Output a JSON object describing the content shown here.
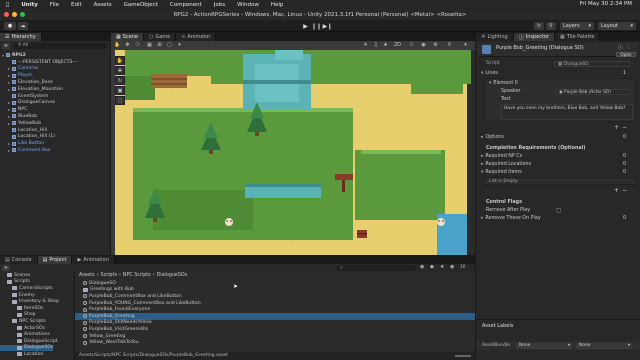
{
  "menubar": {
    "app": "Unity",
    "items": [
      "File",
      "Edit",
      "Assets",
      "GameObject",
      "Component",
      "Jobs",
      "Window",
      "Help"
    ],
    "clock": "Fri May 30 2:34 PM"
  },
  "window": {
    "title": "RPG2 - ActionRPGSeries - Windows, Mac, Linux - Unity 2021.3.1f1 Personal (Personal) <Metal> <Rosetta>"
  },
  "toolbar": {
    "layers": "Layers",
    "layout": "Layout"
  },
  "hierarchy": {
    "tab": "Hierarchy",
    "search": "All",
    "items": [
      {
        "label": "RPG2",
        "indent": 0,
        "blue": false,
        "arrow": "▾",
        "icon": "scene"
      },
      {
        "label": "---PERSISTENT OBJECTS---",
        "indent": 1,
        "blue": false,
        "arrow": "",
        "icon": "cube"
      },
      {
        "label": "Cameras",
        "indent": 1,
        "blue": true,
        "arrow": "▸",
        "icon": "cube"
      },
      {
        "label": "Player",
        "indent": 1,
        "blue": true,
        "arrow": "▸",
        "icon": "cube"
      },
      {
        "label": "Elevation_Base",
        "indent": 1,
        "blue": false,
        "arrow": "▸",
        "icon": "cube"
      },
      {
        "label": "Elevation_Mountain",
        "indent": 1,
        "blue": false,
        "arrow": "▸",
        "icon": "cube"
      },
      {
        "label": "EventSystem",
        "indent": 1,
        "blue": false,
        "arrow": "",
        "icon": "cube"
      },
      {
        "label": "DialogueCanvas",
        "indent": 1,
        "blue": false,
        "arrow": "▸",
        "icon": "cube"
      },
      {
        "label": "NPC",
        "indent": 1,
        "blue": false,
        "arrow": "▸",
        "icon": "cube"
      },
      {
        "label": "BlueBob",
        "indent": 1,
        "blue": false,
        "arrow": "▸",
        "icon": "cube"
      },
      {
        "label": "YellowBob",
        "indent": 1,
        "blue": false,
        "arrow": "▸",
        "icon": "cube"
      },
      {
        "label": "Location_Hill",
        "indent": 1,
        "blue": false,
        "arrow": "",
        "icon": "cube"
      },
      {
        "label": "Location_Hill (1)",
        "indent": 1,
        "blue": false,
        "arrow": "",
        "icon": "cube"
      },
      {
        "label": "Like Button",
        "indent": 1,
        "blue": true,
        "arrow": "▸",
        "icon": "cube"
      },
      {
        "label": "Comment Box",
        "indent": 1,
        "blue": true,
        "arrow": "▸",
        "icon": "cube"
      }
    ]
  },
  "sceneTabs": {
    "scene": "Scene",
    "game": "Game",
    "animator": "Animator"
  },
  "inspector": {
    "tabs": {
      "lighting": "Lighting",
      "inspector": "Inspector",
      "tilePalette": "Tile Palette"
    },
    "title": "Purple Bob_Greeting (Dialogue SO)",
    "open": "Open",
    "script_label": "Script",
    "script_value": "DialogueSO",
    "lines_label": "Lines",
    "lines_count": "1",
    "element_label": "Element 0",
    "speaker_label": "Speaker",
    "speaker_value": "Purple Bob (Actor SO)",
    "text_label": "Text",
    "text_value": "Have you seen my brothers, Blue Bob, and Yellow Bob?",
    "options_label": "Options",
    "options_count": "0",
    "completion_label": "Completion Requirements (Optional)",
    "req_npcs": "Required NP Cs",
    "req_npcs_count": "0",
    "req_locations": "Required Locations",
    "req_locations_count": "0",
    "req_items": "Required Items",
    "req_items_count": "0",
    "list_empty": "List is Empty",
    "control_flags": "Control Flags",
    "remove_after_play": "Remove After Play",
    "remove_these": "Remove These On Play",
    "remove_these_count": "0",
    "asset_labels": "Asset Labels",
    "asset_bundle": "AssetBundle",
    "asset_bundle_value": "None",
    "asset_bundle_value2": "None"
  },
  "bottom": {
    "tabs": {
      "console": "Console",
      "project": "Project",
      "animation": "Animation"
    },
    "breadcrumb": [
      "Assets",
      "Scripts",
      "NPC Scripts",
      "DialogueSOs"
    ],
    "count": "16",
    "tree": [
      {
        "label": "Scenes",
        "indent": 1
      },
      {
        "label": "Scripts",
        "indent": 1
      },
      {
        "label": "CameraScripts",
        "indent": 2
      },
      {
        "label": "Enemy",
        "indent": 2
      },
      {
        "label": "Inventory & Shop",
        "indent": 2
      },
      {
        "label": "ItemSOs",
        "indent": 3
      },
      {
        "label": "Shop",
        "indent": 3
      },
      {
        "label": "NPC Scripts",
        "indent": 2
      },
      {
        "label": "ActorSOs",
        "indent": 3
      },
      {
        "label": "Animations",
        "indent": 3
      },
      {
        "label": "DialogueScript",
        "indent": 3
      },
      {
        "label": "DialogueSOs",
        "indent": 3
      },
      {
        "label": "Location",
        "indent": 3
      }
    ],
    "files": [
      {
        "label": "DialogueSO",
        "type": "script",
        "selected": false
      },
      {
        "label": "Greetings with Bob",
        "type": "folder",
        "selected": false
      },
      {
        "label": "PurpleBob_CommentBox and LikeButton",
        "type": "asset",
        "selected": false
      },
      {
        "label": "PurpleBob_YOUNG_CommentBox and LikeButton",
        "type": "asset",
        "selected": false
      },
      {
        "label": "PurpleBob_FoundEveryone",
        "type": "asset",
        "selected": false
      },
      {
        "label": "PurpleBob_Greeting",
        "type": "asset",
        "selected": true
      },
      {
        "label": "PurpleBob_StillNeedsYellow",
        "type": "asset",
        "selected": false
      },
      {
        "label": "PurpleBob_VisitGreenHills",
        "type": "asset",
        "selected": false
      },
      {
        "label": "Yellow_Greeting",
        "type": "asset",
        "selected": false
      },
      {
        "label": "Yellow_WontTalkToYou",
        "type": "asset",
        "selected": false
      }
    ],
    "path": "Assets/Scripts/NPC Scripts/DialogueSOs/PurpleBob_Greeting.asset"
  },
  "colors": {
    "selection": "#2c5d87",
    "blue_text": "#7aa5ff",
    "sand": "#e8cf6e",
    "grass": "#5a9a3c",
    "water": "#5bb3b6"
  }
}
